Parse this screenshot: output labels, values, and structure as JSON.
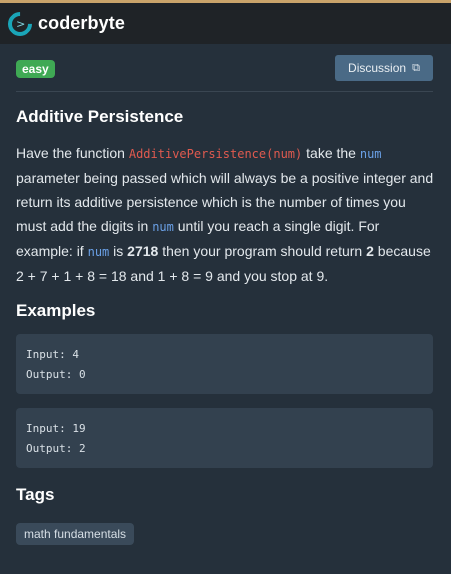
{
  "header": {
    "brand": "coderbyte",
    "logo_glyph": ">"
  },
  "challenge": {
    "difficulty": "easy",
    "discussion_label": "Discussion",
    "title": "Additive Persistence",
    "description": {
      "p1": "Have the function ",
      "fn": "AdditivePersistence(num)",
      "p2": " take the ",
      "arg1": "num",
      "p3": " parameter being passed which will always be a positive integer and return its additive persistence which is the number of times you must add the digits in ",
      "arg2": "num",
      "p4": " until you reach a single digit. For example: if ",
      "arg3": "num",
      "p5": " is ",
      "b1": "2718",
      "p6": " then your program should return ",
      "b2": "2",
      "p7": " because 2 + 7 + 1 + 8 = 18 and 1 + 8 = 9 and you stop at 9."
    }
  },
  "examples": {
    "heading": "Examples",
    "items": [
      {
        "input": "Input: 4",
        "output": "Output: 0"
      },
      {
        "input": "Input: 19",
        "output": "Output: 2"
      }
    ]
  },
  "tags": {
    "heading": "Tags",
    "items": [
      "math fundamentals"
    ]
  },
  "colors": {
    "background": "#25303b",
    "header": "#1f2327",
    "difficulty_badge": "#3fa954",
    "function_name": "#e05a4f",
    "argument": "#6aa0e6"
  }
}
